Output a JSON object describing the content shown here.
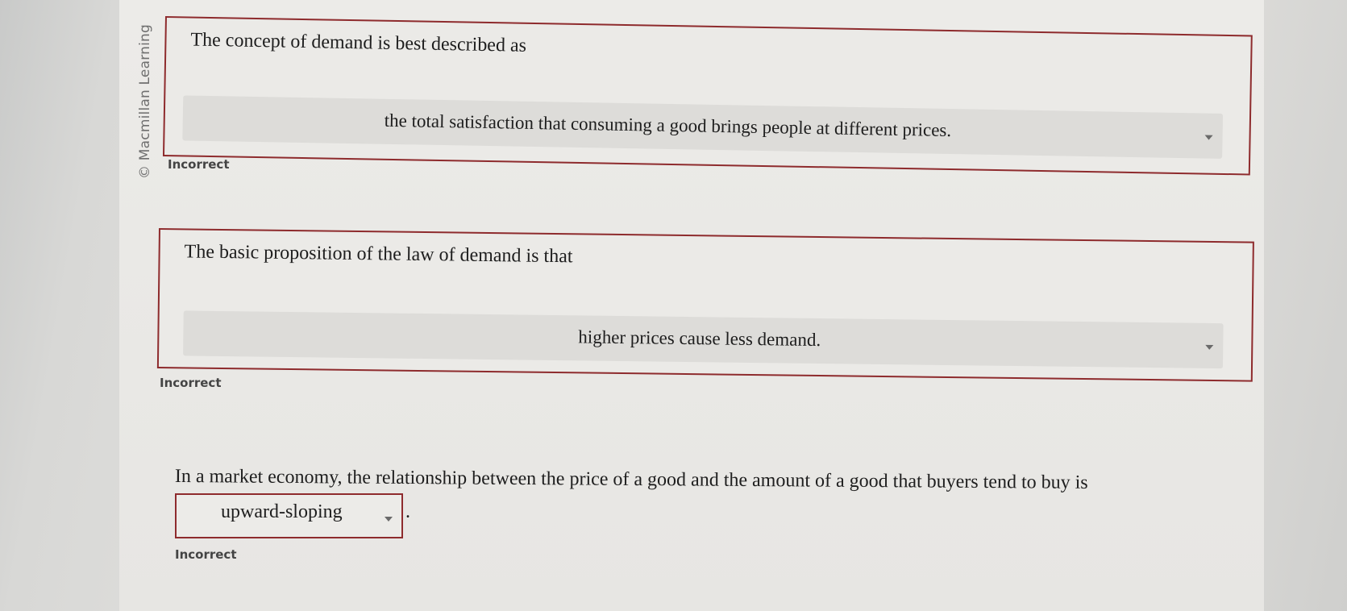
{
  "watermark": "© Macmillan Learning",
  "questions": [
    {
      "prompt": "The concept of demand is best described as",
      "selected": "the total satisfaction that consuming a good brings people at different prices.",
      "status": "Incorrect"
    },
    {
      "prompt": "The basic proposition of the law of demand is that",
      "selected": "higher prices cause less demand.",
      "status": "Incorrect"
    },
    {
      "prompt": "In a market economy, the relationship between the price of a good and the amount of a good that buyers tend to buy is",
      "selected": "upward-sloping",
      "suffix": ".",
      "status": "Incorrect"
    }
  ],
  "colors": {
    "border": "#8e2b2d",
    "page": "#ebeae7",
    "select_bg": "#dddcd9"
  },
  "icons": [
    "chevron-down-icon"
  ]
}
